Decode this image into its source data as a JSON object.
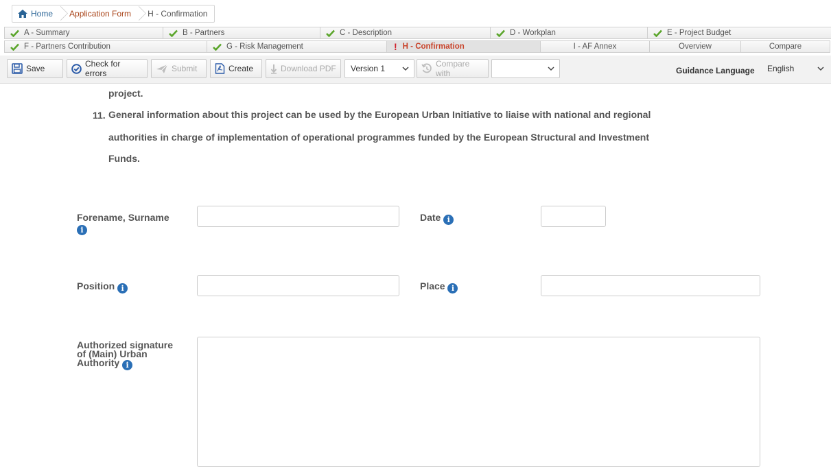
{
  "breadcrumb": {
    "home": "Home",
    "application_form": "Application Form",
    "current": "H - Confirmation"
  },
  "tabs": {
    "row1": [
      {
        "label": "A - Summary",
        "status": "ok"
      },
      {
        "label": "B - Partners",
        "status": "ok"
      },
      {
        "label": "C - Description",
        "status": "ok"
      },
      {
        "label": "D - Workplan",
        "status": "ok"
      },
      {
        "label": "E - Project Budget",
        "status": "ok"
      }
    ],
    "row2": [
      {
        "label": "F - Partners Contribution",
        "status": "ok"
      },
      {
        "label": "G - Risk Management",
        "status": "ok"
      },
      {
        "label": "H - Confirmation",
        "status": "error"
      },
      {
        "label": "I - AF Annex"
      },
      {
        "label": "Overview"
      },
      {
        "label": "Compare"
      }
    ]
  },
  "toolbar": {
    "save": "Save",
    "check_errors": "Check for errors",
    "submit": "Submit",
    "create": "Create",
    "download_pdf": "Download PDF",
    "version_value": "Version 1",
    "compare_with": "Compare with",
    "compare_select_value": "",
    "guidance_label": "Guidance Language",
    "guidance_value": "English"
  },
  "content": {
    "line_prev": "project.",
    "item11_number": "11.",
    "item11_line1": "General information about this project can be used by the European Urban Initiative to liaise with national and regional",
    "item11_line2": "authorities in charge of implementation of operational programmes funded by the European Structural and Investment",
    "item11_line3": "Funds."
  },
  "form": {
    "forename_label": "Forename, Surname",
    "date_label": "Date",
    "position_label": "Position",
    "place_label": "Place",
    "signature_label_1": "Authorized signature",
    "signature_label_2": "of (Main) Urban",
    "signature_label_3": "Authority",
    "forename_value": "",
    "date_value": "",
    "position_value": "",
    "place_value": "",
    "signature_value": ""
  },
  "icons": {
    "home": "home-icon",
    "check": "check-icon",
    "error": "exclamation-icon",
    "info": "info-icon"
  },
  "colors": {
    "link": "#2a6496",
    "breadcrumb_active": "#a94419",
    "tab_active": "#c8432a",
    "check_green": "#5aa52a",
    "error_red": "#d0202a",
    "info_blue": "#2a6fb6"
  }
}
